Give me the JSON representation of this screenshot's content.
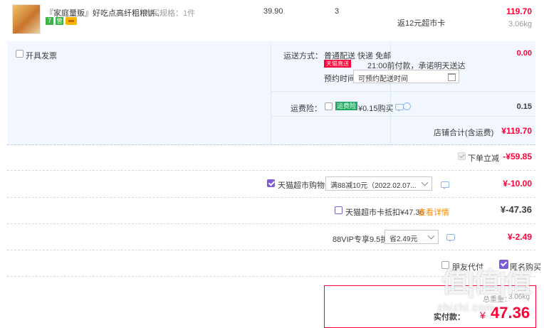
{
  "item": {
    "title": "『家庭量贩』好吃点高纤粗粮饼...",
    "spec": "购买规格：1件",
    "price": "39.90",
    "quantity": "3",
    "rebate": "返12元超市卡",
    "subtotal": "119.70",
    "weight": "3.06kg",
    "badges": [
      "7",
      "营"
    ]
  },
  "invoice": {
    "label": "开具发票"
  },
  "shipping": {
    "label": "运送方式：",
    "method": "普通配送 快递 免邮",
    "express_tag": "天猫直送",
    "promise": "21:00前付款，承诺明天送达",
    "appointment_label": "预约时间",
    "appointment_value": "可预约配送时间",
    "fee": "0.00"
  },
  "insurance": {
    "label": "运费险：",
    "tag": "运费险",
    "text": "¥0.15购买",
    "amount": "0.15"
  },
  "store_total": {
    "label": "店铺合计(含运费)",
    "amount": "¥119.70"
  },
  "discounts": [
    {
      "label": "下单立减",
      "amount": "-¥59.85"
    },
    {
      "label": "天猫超市购物券",
      "select": "满88减10元（2022.02.07...",
      "amount": "¥-10.00"
    },
    {
      "label": "天猫超市卡抵扣¥47.36",
      "link": "查看详情",
      "amount": "¥-47.36"
    },
    {
      "label": "88VIP专享9.5折",
      "select": "省2.49元",
      "amount": "¥-2.49"
    }
  ],
  "options": {
    "friend_pay": "朋友代付",
    "anonymous": "匿名购买"
  },
  "summary": {
    "weight_label": "总重量：",
    "weight": "3.06kg",
    "paid_label": "实付款：",
    "currency": "¥",
    "paid_amount": "47.36"
  },
  "watermark": "值|值|值",
  "watermark_url": "zhizhi.com",
  "colors": {
    "accent_red": "#ff0036",
    "panel_bg": "#f2f7ff",
    "purple": "#7b5cd6"
  }
}
